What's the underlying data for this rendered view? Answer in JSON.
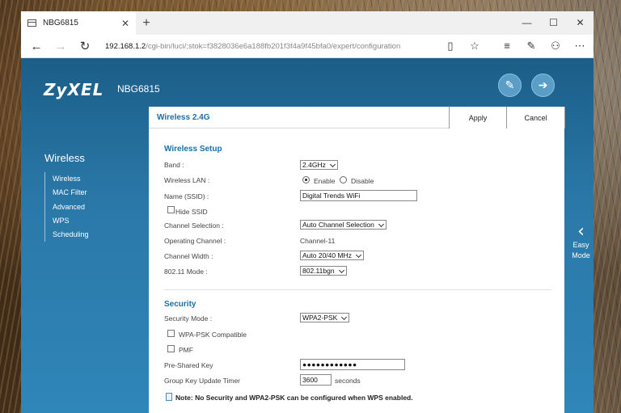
{
  "browser": {
    "tab_title": "NBG6815",
    "new_tab": "+",
    "url_host": "192.168.1.2",
    "url_path": "/cgi-bin/luci/;stok=f3828036e6a188fb201f3f4a9f45bfa0/expert/configuration"
  },
  "router": {
    "brand": "ZyXEL",
    "model": "NBG6815",
    "sidebar": {
      "title": "Wireless",
      "items": [
        "Wireless",
        "MAC Filter",
        "Advanced",
        "WPS",
        "Scheduling"
      ]
    },
    "panel": {
      "title": "Wireless 2.4G",
      "apply": "Apply",
      "cancel": "Cancel"
    },
    "setup": {
      "title": "Wireless Setup",
      "band_label": "Band :",
      "band_value": "2.4GHz",
      "wlan_label": "Wireless LAN :",
      "enable": "Enable",
      "disable": "Disable",
      "ssid_label": "Name (SSID) :",
      "ssid_value": "Digital Trends WiFi",
      "hide_ssid": "Hide SSID",
      "channel_sel_label": "Channel Selection :",
      "channel_sel_value": "Auto Channel Selection",
      "op_channel_label": "Operating Channel :",
      "op_channel_value": "Channel-11",
      "width_label": "Channel Width :",
      "width_value": "Auto 20/40 MHz",
      "mode_label": "802.11 Mode :",
      "mode_value": "802.11bgn"
    },
    "security": {
      "title": "Security",
      "mode_label": "Security Mode :",
      "mode_value": "WPA2-PSK",
      "wpa_compat": "WPA-PSK Compatible",
      "pmf": "PMF",
      "psk_label": "Pre-Shared Key",
      "psk_value": "●●●●●●●●●●●●",
      "timer_label": "Group Key Update Timer",
      "timer_value": "3600",
      "timer_unit": "seconds",
      "note": "Note: No Security and WPA2-PSK can be configured when WPS enabled."
    },
    "easy_mode": {
      "line1": "Easy",
      "line2": "Mode"
    }
  }
}
